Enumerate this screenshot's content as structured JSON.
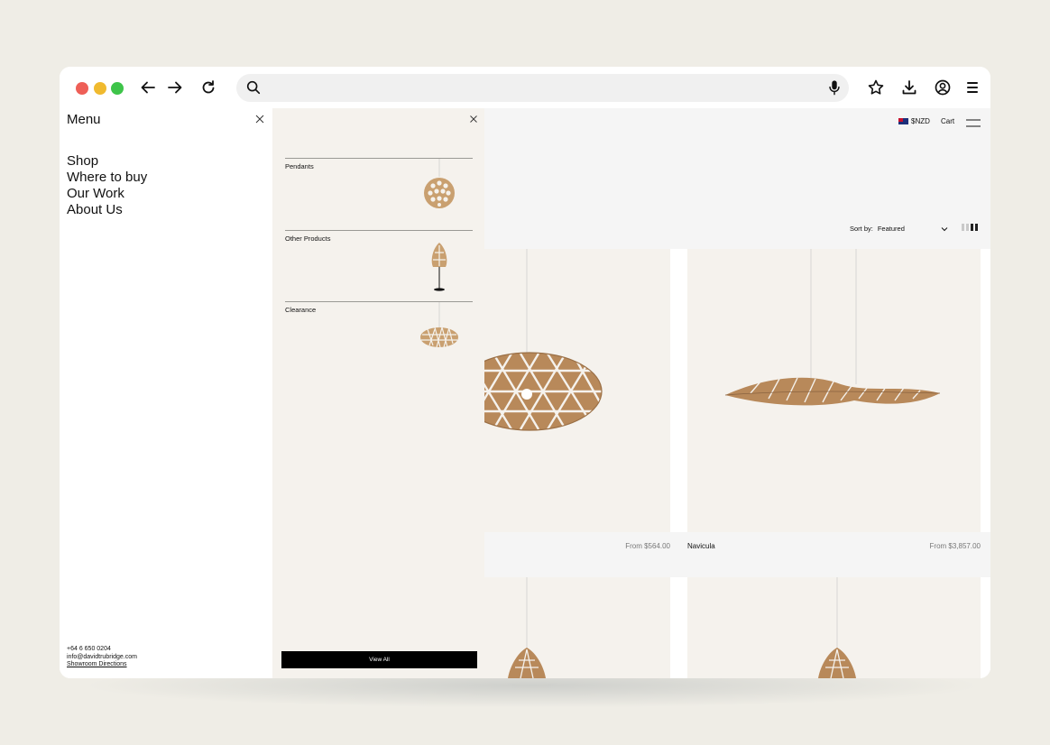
{
  "browser": {
    "url": "",
    "icons": [
      "arrow-left-icon",
      "arrow-right-icon",
      "reload-icon",
      "search-icon",
      "microphone-icon",
      "star-icon",
      "download-icon",
      "account-icon",
      "menu-icon"
    ]
  },
  "menu": {
    "title": "Menu",
    "items": [
      "Shop",
      "Where to buy",
      "Our Work",
      "About Us"
    ],
    "contact": {
      "phone": "+64 6 650 0204",
      "email": "info@davidtrubridge.com",
      "directions": "Showroom Directions"
    }
  },
  "submenu": {
    "categories": [
      {
        "label": "Pendants"
      },
      {
        "label": "Other Products"
      },
      {
        "label": "Clearance"
      }
    ],
    "view_all": "View All"
  },
  "shop": {
    "currency": "$NZD",
    "cart": "Cart",
    "sort_label": "Sort by:",
    "sort_value": "Featured",
    "products": [
      {
        "name": "",
        "price": "From $564.00"
      },
      {
        "name": "Navicula",
        "price": "From $3,857.00"
      }
    ]
  },
  "colors": {
    "panel_bg": "#f5f2ed",
    "header_bg": "#f5f5f5",
    "bamboo": "#b8895a"
  }
}
